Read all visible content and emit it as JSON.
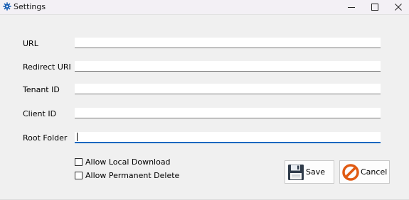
{
  "window": {
    "title": "Settings",
    "icon": "gear-icon",
    "controls": {
      "minimize": "minimize-icon",
      "maximize": "maximize-icon",
      "close": "close-icon"
    }
  },
  "form": {
    "fields": [
      {
        "label": "URL",
        "value": ""
      },
      {
        "label": "Redirect URI",
        "value": ""
      },
      {
        "label": "Tenant ID",
        "value": ""
      },
      {
        "label": "Client ID",
        "value": ""
      },
      {
        "label": "Root Folder",
        "value": "",
        "focused": true
      }
    ],
    "checkboxes": [
      {
        "label": "Allow Local Download",
        "checked": false
      },
      {
        "label": "Allow Permanent Delete",
        "checked": false
      }
    ]
  },
  "buttons": {
    "save": {
      "label": "Save",
      "icon": "floppy-disk-icon"
    },
    "cancel": {
      "label": "Cancel",
      "icon": "cancel-icon"
    }
  },
  "colors": {
    "focus_accent": "#0067c0",
    "app_icon": "#1a5fb4",
    "cancel_icon": "#e05a12"
  }
}
